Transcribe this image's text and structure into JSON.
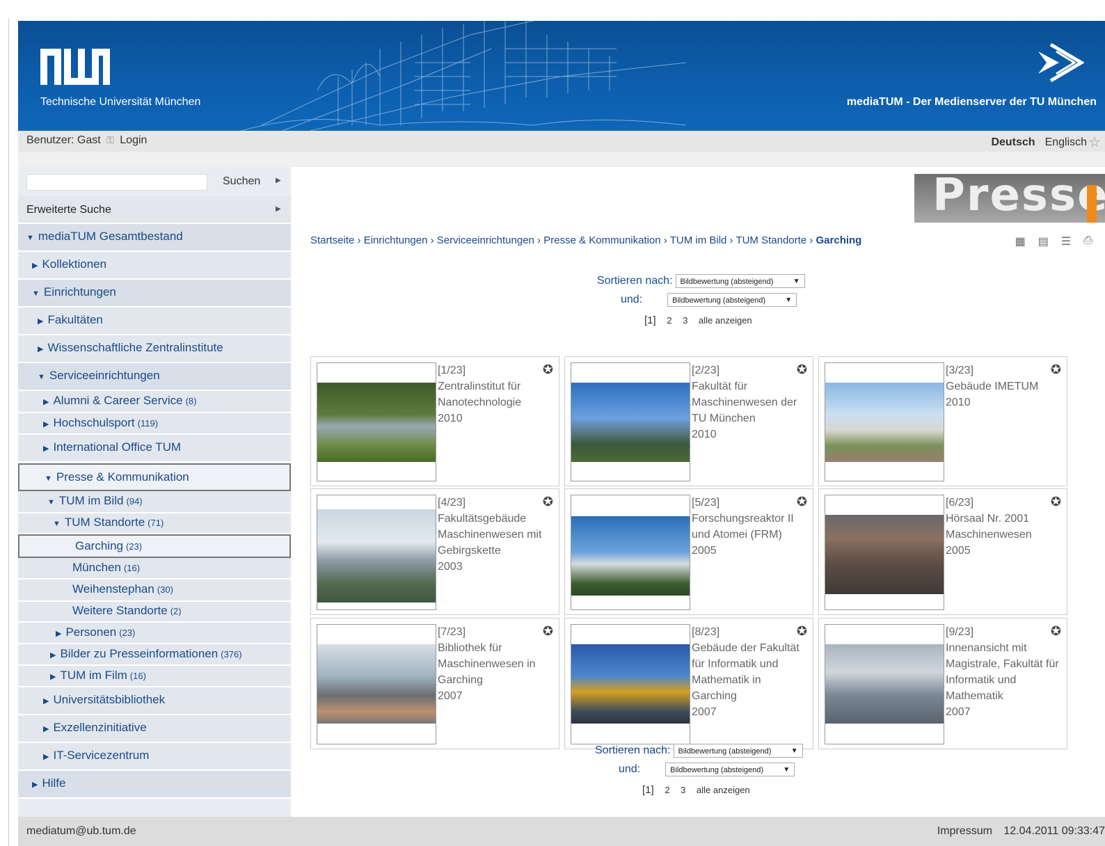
{
  "header": {
    "tum_name": "Technische Universität München",
    "media_title": "mediaTUM - Der Medienserver der TU München"
  },
  "userbar": {
    "user_label": "Benutzer: Gast",
    "login": "Login",
    "lang_de": "Deutsch",
    "lang_en": "Englisch"
  },
  "sidebar": {
    "search_label": "Suchen",
    "advanced": "Erweiterte Suche",
    "items": [
      {
        "label": "mediaTUM Gesamtbestand",
        "count": "",
        "open": true
      },
      {
        "label": "Kollektionen",
        "count": "",
        "open": false
      },
      {
        "label": "Einrichtungen",
        "count": "",
        "open": true
      },
      {
        "label": "Fakultäten",
        "count": "",
        "open": false
      },
      {
        "label": "Wissenschaftliche Zentralinstitute",
        "count": "",
        "open": false
      },
      {
        "label": "Serviceeinrichtungen",
        "count": "",
        "open": true
      },
      {
        "label": "Alumni & Career Service",
        "count": "(8)",
        "open": false
      },
      {
        "label": "Hochschulsport",
        "count": "(119)",
        "open": false
      },
      {
        "label": "International Office TUM",
        "count": "",
        "open": false
      },
      {
        "label": "Presse & Kommunikation",
        "count": "",
        "open": true
      },
      {
        "label": "TUM im Bild",
        "count": "(94)",
        "open": true
      },
      {
        "label": "TUM Standorte",
        "count": "(71)",
        "open": true
      },
      {
        "label": "Garching",
        "count": "(23)",
        "open": null
      },
      {
        "label": "München",
        "count": "(16)",
        "open": null
      },
      {
        "label": "Weihenstephan",
        "count": "(30)",
        "open": null
      },
      {
        "label": "Weitere Standorte",
        "count": "(2)",
        "open": null
      },
      {
        "label": "Personen",
        "count": "(23)",
        "open": false
      },
      {
        "label": "Bilder zu Presseinformationen",
        "count": "(376)",
        "open": false
      },
      {
        "label": "TUM im Film",
        "count": "(16)",
        "open": false
      },
      {
        "label": "Universitätsbibliothek",
        "count": "",
        "open": false
      },
      {
        "label": "Exzellenzinitiative",
        "count": "",
        "open": false
      },
      {
        "label": "IT-Servicezentrum",
        "count": "",
        "open": false
      },
      {
        "label": "Hilfe",
        "count": "",
        "open": false
      }
    ]
  },
  "main": {
    "presse_banner": "Presse",
    "breadcrumb": [
      "Startseite",
      "Einrichtungen",
      "Serviceeinrichtungen",
      "Presse & Kommunikation",
      "TUM im Bild",
      "TUM Standorte"
    ],
    "breadcrumb_current": "Garching",
    "sort_label": "Sortieren nach:",
    "and_label": "und:",
    "sort_value": "Bildbewertung (absteigend)",
    "pages": [
      "[1]",
      "2",
      "3"
    ],
    "show_all": "alle anzeigen",
    "cards": [
      {
        "idx": "[1/23]",
        "title": "Zentralinstitut für Nanotechnologie",
        "year": "2010"
      },
      {
        "idx": "[2/23]",
        "title": "Fakultät für Maschinenwesen der TU München",
        "year": "2010"
      },
      {
        "idx": "[3/23]",
        "title": "Gebäude IMETUM",
        "year": "2010"
      },
      {
        "idx": "[4/23]",
        "title": "Fakultätsgebäude Maschinenwesen mit Gebirgskette",
        "year": "2003"
      },
      {
        "idx": "[5/23]",
        "title": "Forschungsreaktor II und Atomei (FRM)",
        "year": "2005"
      },
      {
        "idx": "[6/23]",
        "title": "Hörsaal Nr. 2001 Maschinenwesen",
        "year": "2005"
      },
      {
        "idx": "[7/23]",
        "title": "Bibliothek für Maschinenwesen in Garching",
        "year": "2007"
      },
      {
        "idx": "[8/23]",
        "title": "Gebäude der Fakultät für Informatik und Mathematik in Garching",
        "year": "2007"
      },
      {
        "idx": "[9/23]",
        "title": "Innenansicht mit Magistrale, Fakultät für Informatik und Mathematik",
        "year": "2007"
      }
    ]
  },
  "footer": {
    "email": "mediatum@ub.tum.de",
    "impressum": "Impressum",
    "timestamp": "12.04.2011 09:33:47"
  }
}
